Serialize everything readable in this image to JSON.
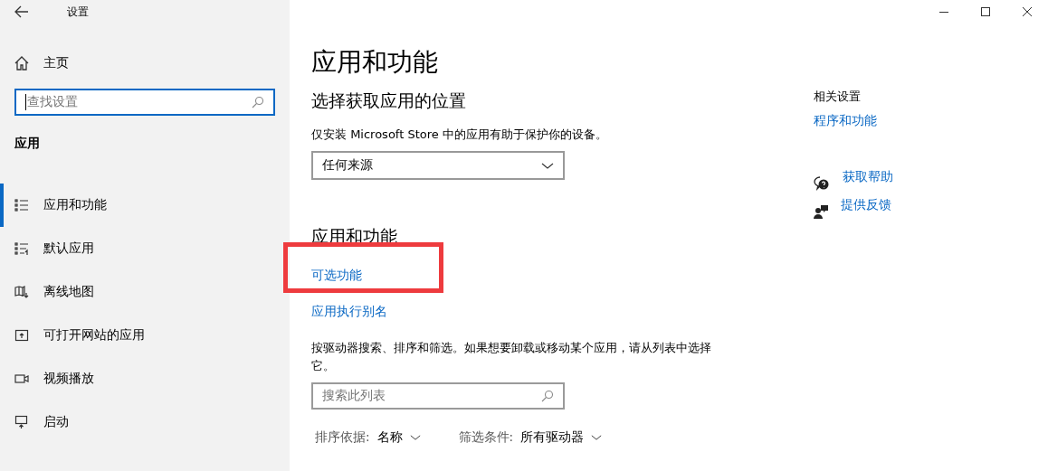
{
  "window": {
    "title": "设置"
  },
  "sidebar": {
    "home": "主页",
    "search": {
      "placeholder": "查找设置"
    },
    "section": "应用",
    "items": [
      {
        "label": "应用和功能",
        "kind": "list",
        "selected": true
      },
      {
        "label": "默认应用",
        "kind": "default",
        "selected": false
      },
      {
        "label": "离线地图",
        "kind": "map",
        "selected": false
      },
      {
        "label": "可打开网站的应用",
        "kind": "web",
        "selected": false
      },
      {
        "label": "视频播放",
        "kind": "video",
        "selected": false
      },
      {
        "label": "启动",
        "kind": "startup",
        "selected": false
      }
    ]
  },
  "main": {
    "title": "应用和功能",
    "location_heading": "选择获取应用的位置",
    "location_desc": "仅安装 Microsoft Store 中的应用有助于保护你的设备。",
    "source_dropdown": "任何来源",
    "apps_heading": "应用和功能",
    "links": [
      {
        "label": "可选功能",
        "highlighted": true
      },
      {
        "label": "应用执行别名",
        "highlighted": false
      }
    ],
    "apps_desc": "按驱动器搜索、排序和筛选。如果想要卸载或移动某个应用，请从列表中选择它。",
    "list_search": {
      "placeholder": "搜索此列表"
    },
    "sort": {
      "label": "排序依据:",
      "value": "名称"
    },
    "filter": {
      "label": "筛选条件:",
      "value": "所有驱动器"
    }
  },
  "related": {
    "heading": "相关设置",
    "link": "程序和功能",
    "help": [
      {
        "kind": "help",
        "label": "获取帮助"
      },
      {
        "kind": "feedback",
        "label": "提供反馈"
      }
    ]
  }
}
